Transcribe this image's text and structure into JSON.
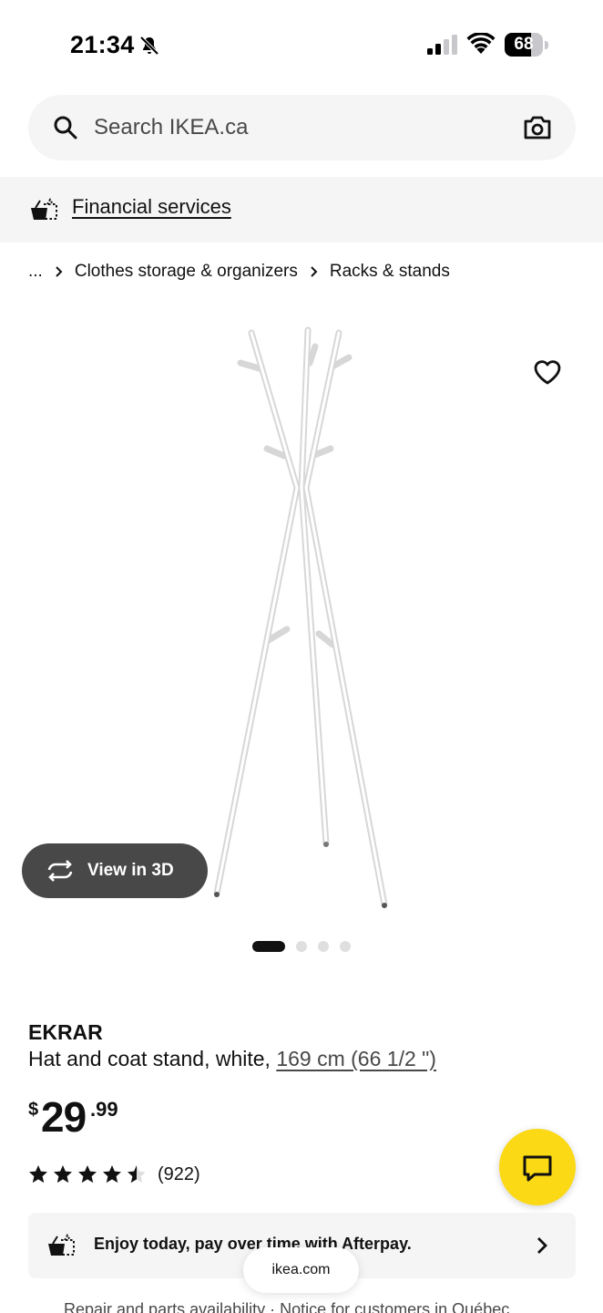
{
  "status_bar": {
    "time": "21:34",
    "battery_level": "68",
    "battery_fraction": 0.68
  },
  "search": {
    "placeholder": "Search IKEA.ca"
  },
  "financial": {
    "label": "Financial services"
  },
  "breadcrumb": {
    "items": [
      "...",
      "Clothes storage & organizers",
      "Racks & stands"
    ]
  },
  "gallery": {
    "view3d_label": "View in 3D",
    "image_count": 4,
    "active_index": 0
  },
  "product": {
    "name": "EKRAR",
    "description": "Hat and coat stand, white, ",
    "measurement": "169 cm (66 1/2 \")",
    "price": {
      "currency": "$",
      "integer": "29",
      "decimal": ".99"
    },
    "rating": 4.5,
    "review_count": "(922)"
  },
  "afterpay": {
    "text": "Enjoy today, pay over time with Afterpay."
  },
  "footer": {
    "text": "Repair and parts availability · Notice for customers in Québec"
  },
  "browser": {
    "url": "ikea.com"
  },
  "icons": {
    "search": "search-icon",
    "camera": "camera-icon",
    "basket": "basket-icon",
    "heart": "heart-icon",
    "rotate": "rotate-3d-icon",
    "chat": "chat-icon"
  },
  "colors": {
    "accent_yellow": "#fbd914",
    "dark_pill": "#484848",
    "light_gray": "#f5f5f5"
  }
}
